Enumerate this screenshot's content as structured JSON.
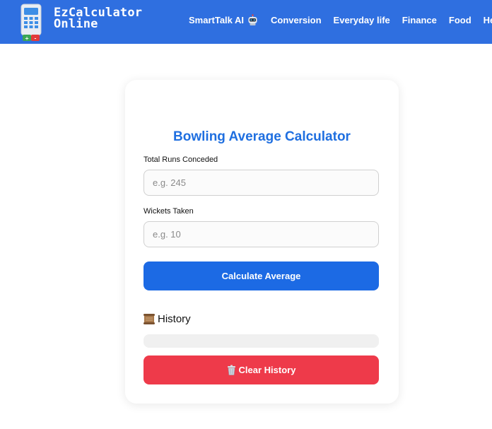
{
  "header": {
    "brand_line1": "EzCalculator",
    "brand_line2": "Online",
    "nav": [
      {
        "label": "SmartTalk AI",
        "icon": "robot-icon"
      },
      {
        "label": "Conversion"
      },
      {
        "label": "Everyday life"
      },
      {
        "label": "Finance"
      },
      {
        "label": "Food"
      },
      {
        "label": "Health"
      }
    ],
    "color": "#2f6fe0"
  },
  "calculator": {
    "title": "Bowling Average Calculator",
    "runs_label": "Total Runs Conceded",
    "runs_placeholder": "e.g. 245",
    "runs_value": "",
    "wickets_label": "Wickets Taken",
    "wickets_placeholder": "e.g. 10",
    "wickets_value": "",
    "calculate_label": "Calculate Average",
    "calculate_color": "#1c6ae4"
  },
  "history": {
    "heading": "History",
    "heading_icon": "scroll-icon",
    "items": [],
    "clear_label": "Clear History",
    "clear_icon": "trash-icon",
    "clear_color": "#ee3a4a"
  }
}
